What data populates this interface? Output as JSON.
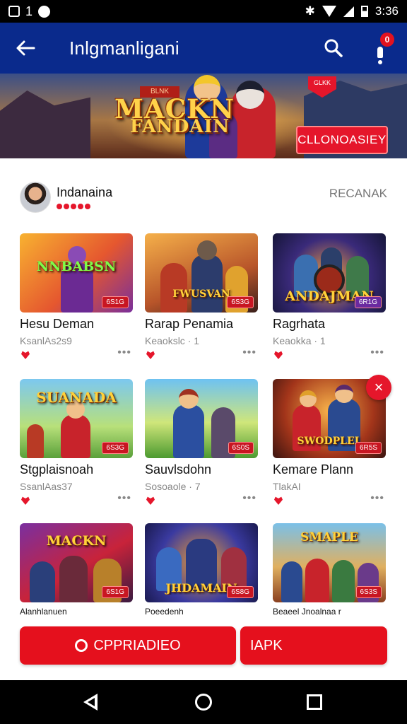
{
  "status_bar": {
    "left_text": "1",
    "time": "3:36",
    "icons": [
      "screenshot-icon",
      "game-icon",
      "bluetooth-icon",
      "wifi-icon",
      "signal-icon",
      "battery-icon"
    ]
  },
  "app_bar": {
    "title": "Inlgmanligani",
    "back_icon": "arrow-left-icon",
    "search_icon": "search-icon",
    "notification_count": "0"
  },
  "banner": {
    "tag": "BLNK",
    "title_line1": "MACKN",
    "title_line2": "FANDAIN",
    "heart_label": "GLKK",
    "button_label": "CLLONOASIEY"
  },
  "author": {
    "name": "Indanaina",
    "link": "RECANAK"
  },
  "games": [
    {
      "title": "Hesu Deman",
      "sub": "KsanlAs2s9",
      "thumb_word": "NNBABSN",
      "badge": "6S1G"
    },
    {
      "title": "Rarap Penamia",
      "sub": "Keaokslc · 1",
      "thumb_word": "FWUSVAN",
      "badge": "6S3G"
    },
    {
      "title": "Ragrhata",
      "sub": "Keaokka · 1",
      "thumb_word": "ANDAJMAN",
      "badge": "6R1G"
    },
    {
      "title": "Stgplaisnoah",
      "sub": "SsanlAas37",
      "thumb_word": "SUANADA",
      "badge": "6S3G"
    },
    {
      "title": "Sauvlsdohn",
      "sub": "Sosoaole · 7",
      "thumb_word": "",
      "badge": "6S0S"
    },
    {
      "title": "Kemare Plann",
      "sub": "TlakAI",
      "thumb_word": "SWODPLEL",
      "badge": "6R5S"
    },
    {
      "title": "Alanhlanuen",
      "sub": "",
      "thumb_word": "MACKN",
      "badge": "6S1G"
    },
    {
      "title": "Poeedenh",
      "sub": "",
      "thumb_word": "JHDAMAIN",
      "badge": "6S8G"
    },
    {
      "title": "Beaeel Jnoalnaa r",
      "sub": "",
      "thumb_word": "SMAPLE",
      "badge": "6S3S"
    }
  ],
  "close_icon_label": "×",
  "more_glyph": "•••",
  "cta": {
    "primary_label": "CPPRIADIEO",
    "secondary_label": "IAPK"
  },
  "nav": {
    "icons": [
      "back-triangle-icon",
      "home-circle-icon",
      "recents-square-icon"
    ]
  },
  "colors": {
    "app_bar": "#0a2a8c",
    "accent": "#e5162b"
  }
}
